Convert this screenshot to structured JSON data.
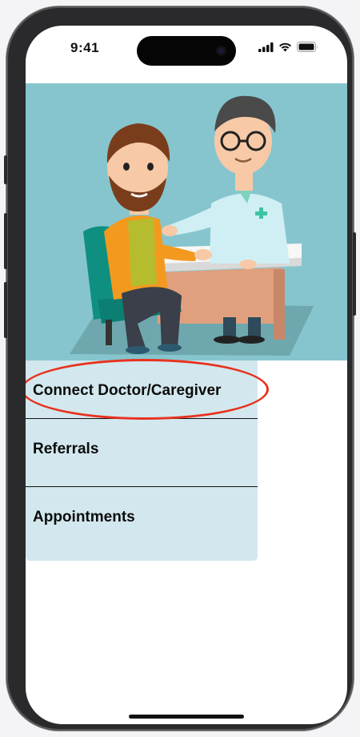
{
  "status_bar": {
    "time": "9:41",
    "icons": [
      "cellular-signal-icon",
      "wifi-icon",
      "battery-icon"
    ]
  },
  "hero": {
    "illustration": "doctor-consulting-patient-illustration",
    "background_color": "#86c5ce"
  },
  "menu": {
    "background_color": "#d3e8ee",
    "items": [
      {
        "label": "Connect Doctor/Caregiver",
        "highlighted": true
      },
      {
        "label": "Referrals"
      },
      {
        "label": "Appointments"
      }
    ]
  },
  "annotation": {
    "color": "#e8321e"
  }
}
